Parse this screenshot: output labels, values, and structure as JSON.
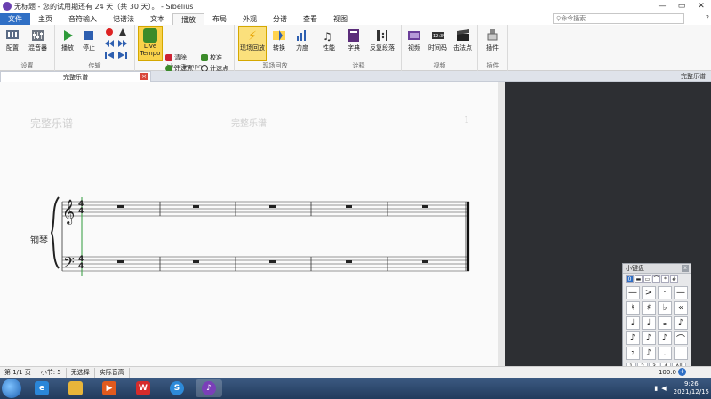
{
  "titlebar": {
    "title": "无标题 - 您的试用期还有 24 天（共 30 天）。 - Sibelius",
    "minimize": "—",
    "maximize": "▭",
    "close": "✕"
  },
  "tabs": [
    {
      "label": "文件"
    },
    {
      "label": "主页"
    },
    {
      "label": "音符输入"
    },
    {
      "label": "记谱法"
    },
    {
      "label": "文本"
    },
    {
      "label": "播放"
    },
    {
      "label": "布局"
    },
    {
      "label": "外观"
    },
    {
      "label": "分谱"
    },
    {
      "label": "查看"
    },
    {
      "label": "视图"
    }
  ],
  "search": {
    "placeholder": "命令搜索"
  },
  "ribbon": {
    "setup": {
      "config": "配置",
      "mixer": "混音器",
      "group": "设置"
    },
    "transport": {
      "play": "播放",
      "stop": "停止",
      "group": "传输"
    },
    "live_tempo": {
      "button": "Live Tempo",
      "clear": "清除",
      "tap_point": "计速点",
      "record": "录制",
      "verify": "校准",
      "tap_point2": "计速点",
      "display": "显示",
      "group": "Live Tempo"
    },
    "live_playback": {
      "playback_return": "现场回放",
      "convert": "转换",
      "dynamics": "力度",
      "group": "现场回放"
    },
    "interpretation": {
      "performance": "性能",
      "dictionary": "字典",
      "repeat": "反复段落",
      "group": "诠释"
    },
    "video": {
      "video": "视频",
      "timecode": "时间码",
      "hitpoints": "击法点",
      "group": "视频"
    },
    "plugins": {
      "plugins": "插件",
      "group": "插件"
    }
  },
  "doc_tab": {
    "label": "完整乐谱",
    "right_label": "完整乐谱"
  },
  "score": {
    "watermark_left": "完整乐谱",
    "watermark_center": "完整乐谱",
    "page_number": "1",
    "instrument": "钢琴",
    "time_sig_top": "4",
    "time_sig_bottom": "4"
  },
  "keypad": {
    "title": "小键盘",
    "close": "x",
    "top_row": [
      "0",
      "▬",
      "▭",
      "⌒",
      "*",
      "#"
    ],
    "grid": [
      "—",
      ">",
      "·",
      "—",
      "♮",
      "♯",
      "♭",
      "«",
      "♩",
      "♩",
      "𝅝",
      "♪",
      "♪",
      "♪",
      "♪",
      "⌒",
      "𝄾",
      "♪",
      ".",
      ""
    ],
    "bottom_row": [
      "1",
      "2",
      "3",
      "4",
      "All"
    ]
  },
  "status": {
    "page": "第 1/1 页",
    "bar": "小节: 5",
    "selection": "无选择",
    "pitch": "实际音高",
    "zoom": "100.0"
  },
  "taskbar": {
    "time": "9:26",
    "date": "2021/12/15"
  },
  "colors": {
    "file_tab": "#2f6fc5",
    "live_tempo": "#f9d24a",
    "workspace": "#2d2f33",
    "taskbar": "#2a4566"
  }
}
